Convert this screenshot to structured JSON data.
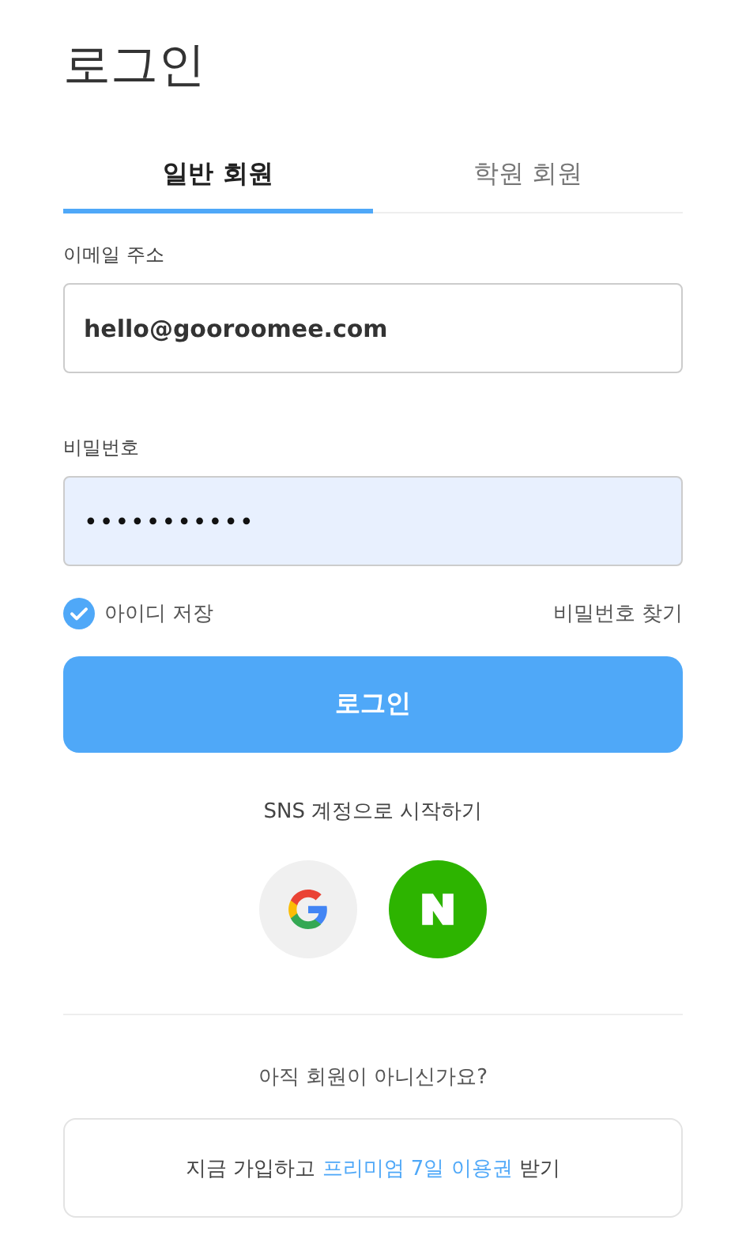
{
  "title": "로그인",
  "tabs": [
    {
      "label": "일반 회원",
      "selected": true
    },
    {
      "label": "학원 회원",
      "selected": false
    }
  ],
  "email": {
    "label": "이메일 주소",
    "value": "hello@gooroomee.com",
    "autofilled": false
  },
  "password": {
    "label": "비밀번호",
    "value": "•••••••••••",
    "autofilled": true
  },
  "remember": {
    "label": "아이디 저장",
    "checked": true
  },
  "find_password": "비밀번호 찾기",
  "login_button": "로그인",
  "sns": {
    "caption": "SNS 계정으로 시작하기",
    "providers": [
      {
        "kind": "google"
      },
      {
        "kind": "naver"
      }
    ]
  },
  "signup": {
    "question": "아직 회원이 아니신가요?",
    "text_before": "지금 가입하고",
    "link": "프리미엄 7일 이용권",
    "text_after": "받기"
  }
}
